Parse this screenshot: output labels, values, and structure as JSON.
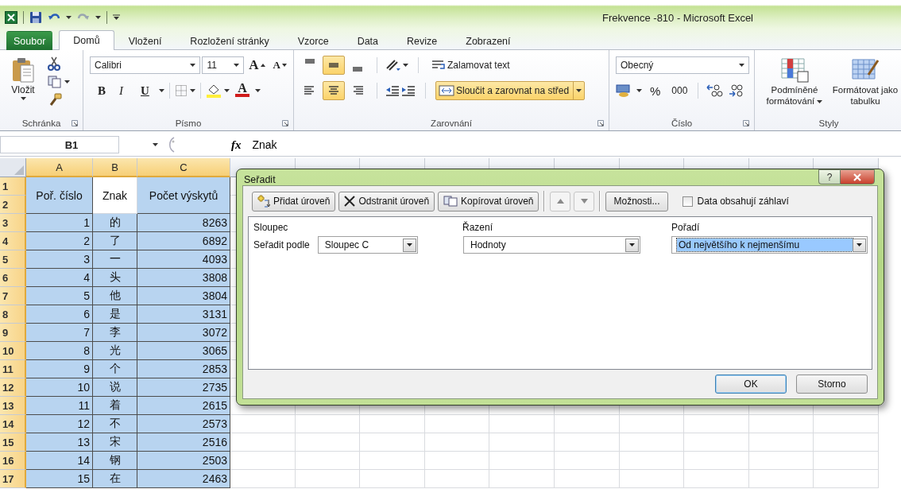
{
  "title_bar": {
    "title": "Frekvence -810  -  Microsoft Excel"
  },
  "ribbon_tabs": [
    {
      "label": "Soubor",
      "kind": "file",
      "selected": false
    },
    {
      "label": "Domů",
      "kind": "tab",
      "selected": true
    },
    {
      "label": "Vložení",
      "kind": "tab",
      "selected": false
    },
    {
      "label": "Rozložení stránky",
      "kind": "tab",
      "selected": false
    },
    {
      "label": "Vzorce",
      "kind": "tab",
      "selected": false
    },
    {
      "label": "Data",
      "kind": "tab",
      "selected": false
    },
    {
      "label": "Revize",
      "kind": "tab",
      "selected": false
    },
    {
      "label": "Zobrazení",
      "kind": "tab",
      "selected": false
    }
  ],
  "ribbon": {
    "clipboard": {
      "paste": "Vložit",
      "label": "Schránka"
    },
    "font": {
      "name": "Calibri",
      "size": "11",
      "grow": "A",
      "shrink": "A",
      "bold": "B",
      "italic": "I",
      "underline": "U",
      "font_color": "A",
      "label": "Písmo"
    },
    "alignment": {
      "vertical": [
        {
          "selected": false
        },
        {
          "selected": true
        },
        {
          "selected": false
        }
      ],
      "horizontal": [
        {
          "selected": false
        },
        {
          "selected": true
        },
        {
          "selected": false
        }
      ],
      "wrap": "Zalamovat text",
      "merge": {
        "label": "Sloučit a zarovnat na střed",
        "on": true
      },
      "label": "Zarovnání"
    },
    "number": {
      "format": "Obecný",
      "percent": "%",
      "thousands": "000",
      "label": "Číslo"
    },
    "styles": {
      "conditional": "Podmíněné formátování",
      "format_table": "Formátovat jako tabulku",
      "label": "Styly"
    }
  },
  "formula_bar": {
    "name_box": "B1",
    "fx": "fx",
    "value": "Znak"
  },
  "sheet": {
    "columns": [
      {
        "label": "A",
        "selected": true
      },
      {
        "label": "B",
        "selected": true
      },
      {
        "label": "C",
        "selected": true
      }
    ],
    "rows": [
      {
        "label": "1",
        "selected": true
      },
      {
        "label": "2",
        "selected": true
      },
      {
        "label": "3",
        "selected": true
      },
      {
        "label": "4",
        "selected": true
      },
      {
        "label": "5",
        "selected": true
      },
      {
        "label": "6",
        "selected": true
      },
      {
        "label": "7",
        "selected": true
      },
      {
        "label": "8",
        "selected": true
      },
      {
        "label": "9",
        "selected": true
      },
      {
        "label": "10",
        "selected": true
      },
      {
        "label": "11",
        "selected": true
      },
      {
        "label": "12",
        "selected": true
      },
      {
        "label": "13",
        "selected": true
      },
      {
        "label": "14",
        "selected": true
      },
      {
        "label": "15",
        "selected": true
      },
      {
        "label": "16",
        "selected": true
      },
      {
        "label": "17",
        "selected": true
      }
    ],
    "headers": [
      {
        "text": "Poř. číslo",
        "active": false
      },
      {
        "text": "Znak",
        "active": true
      },
      {
        "text": "Počet výskytů",
        "active": false
      }
    ],
    "data": [
      [
        "1",
        "的",
        "8263"
      ],
      [
        "2",
        "了",
        "6892"
      ],
      [
        "3",
        "一",
        "4093"
      ],
      [
        "4",
        "头",
        "3808"
      ],
      [
        "5",
        "他",
        "3804"
      ],
      [
        "6",
        "是",
        "3131"
      ],
      [
        "7",
        "李",
        "3072"
      ],
      [
        "8",
        "光",
        "3065"
      ],
      [
        "9",
        "个",
        "2853"
      ],
      [
        "10",
        "说",
        "2735"
      ],
      [
        "11",
        "着",
        "2615"
      ],
      [
        "12",
        "不",
        "2573"
      ],
      [
        "13",
        "宋",
        "2516"
      ],
      [
        "14",
        "钢",
        "2503"
      ],
      [
        "15",
        "在",
        "2463"
      ]
    ]
  },
  "sort_dialog": {
    "title": "Seřadit",
    "help_button": "?",
    "toolbar": [
      {
        "kind": "add",
        "label": "Přidat úroveň",
        "disabled": false
      },
      {
        "kind": "delete",
        "label": "Odstranit úroveň",
        "disabled": false
      },
      {
        "kind": "copy",
        "label": "Kopírovat úroveň",
        "disabled": false
      },
      {
        "kind": "up",
        "disabled": true
      },
      {
        "kind": "down",
        "disabled": true
      },
      {
        "kind": "options",
        "label": "Možnosti...",
        "disabled": false
      }
    ],
    "has_headers": {
      "label": "Data obsahují záhlaví",
      "checked": false
    },
    "columns": [
      "Sloupec",
      "Řazení",
      "Pořadí"
    ],
    "levels": [
      {
        "label": "Seřadit podle",
        "column": "Sloupec C",
        "sort_on": "Hodnoty",
        "order": "Od největšího k nejmenšímu",
        "order_highlighted": true
      }
    ],
    "buttons": [
      "OK",
      "Storno"
    ]
  }
}
